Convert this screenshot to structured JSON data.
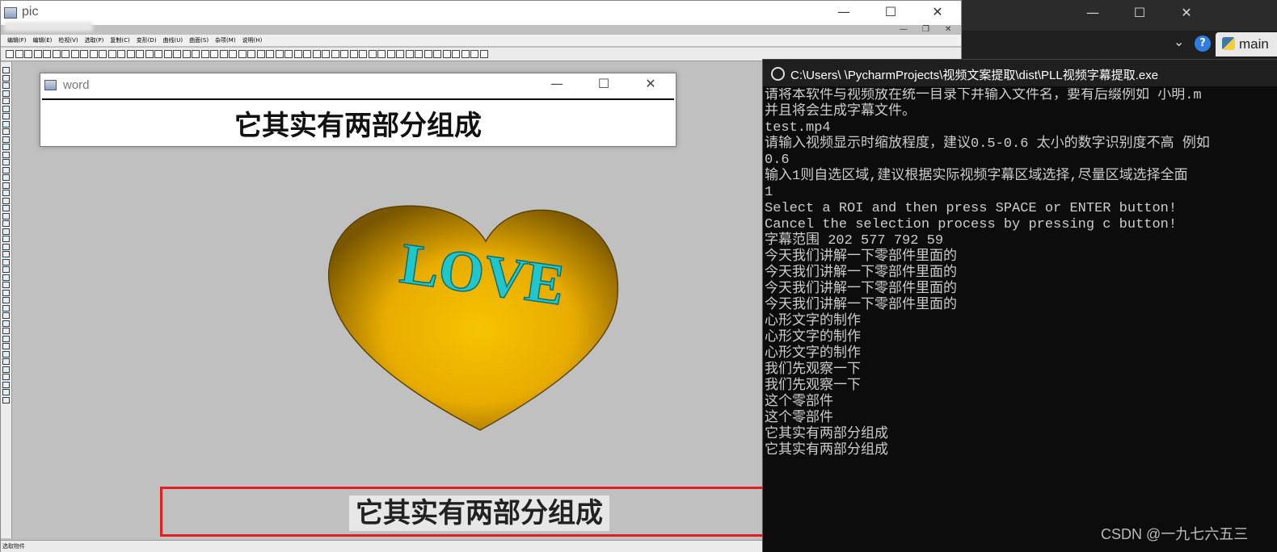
{
  "pic_window": {
    "title": "pic",
    "menu": [
      "编辑(F)",
      "编辑(E)",
      "检视(V)",
      "选取(P)",
      "复制(C)",
      "变形(D)",
      "曲线(U)",
      "曲面(S)",
      "杂项(M)",
      "说明(H)"
    ],
    "status": "选取物件"
  },
  "word_window": {
    "title": "word",
    "text": "它其实有两部分组成"
  },
  "canvas": {
    "heart_text": "LOVE",
    "heart_color": "#f0b400",
    "love_color": "#20c6c9"
  },
  "roi_caption": "它其实有两部分组成",
  "roi_color": "#e02020",
  "console": {
    "title": "C:\\Users\\      \\PycharmProjects\\视频文案提取\\dist\\PLL视频字幕提取.exe",
    "lines": [
      "请将本软件与视频放在统一目录下并输入文件名，要有后缀例如 小明.m",
      "并且将会生成字幕文件。",
      "test.mp4",
      "请输入视频显示时缩放程度，建议0.5-0.6 太小的数字识别度不高 例如",
      "0.6",
      "输入1则自选区域,建议根据实际视频字幕区域选择,尽量区域选择全面",
      "1",
      "Select a ROI and then press SPACE or ENTER button!",
      "Cancel the selection process by pressing c button!",
      "字幕范围 202 577 792 59",
      "今天我们讲解一下零部件里面的",
      "今天我们讲解一下零部件里面的",
      "今天我们讲解一下零部件里面的",
      "今天我们讲解一下零部件里面的",
      "心形文字的制作",
      "心形文字的制作",
      "心形文字的制作",
      "我们先观察一下",
      "我们先观察一下",
      "这个零部件",
      "这个零部件",
      "它其实有两部分组成",
      "它其实有两部分组成"
    ]
  },
  "background_tab": {
    "label": "main",
    "help": "?"
  },
  "watermark": "CSDN @一九七六五三"
}
